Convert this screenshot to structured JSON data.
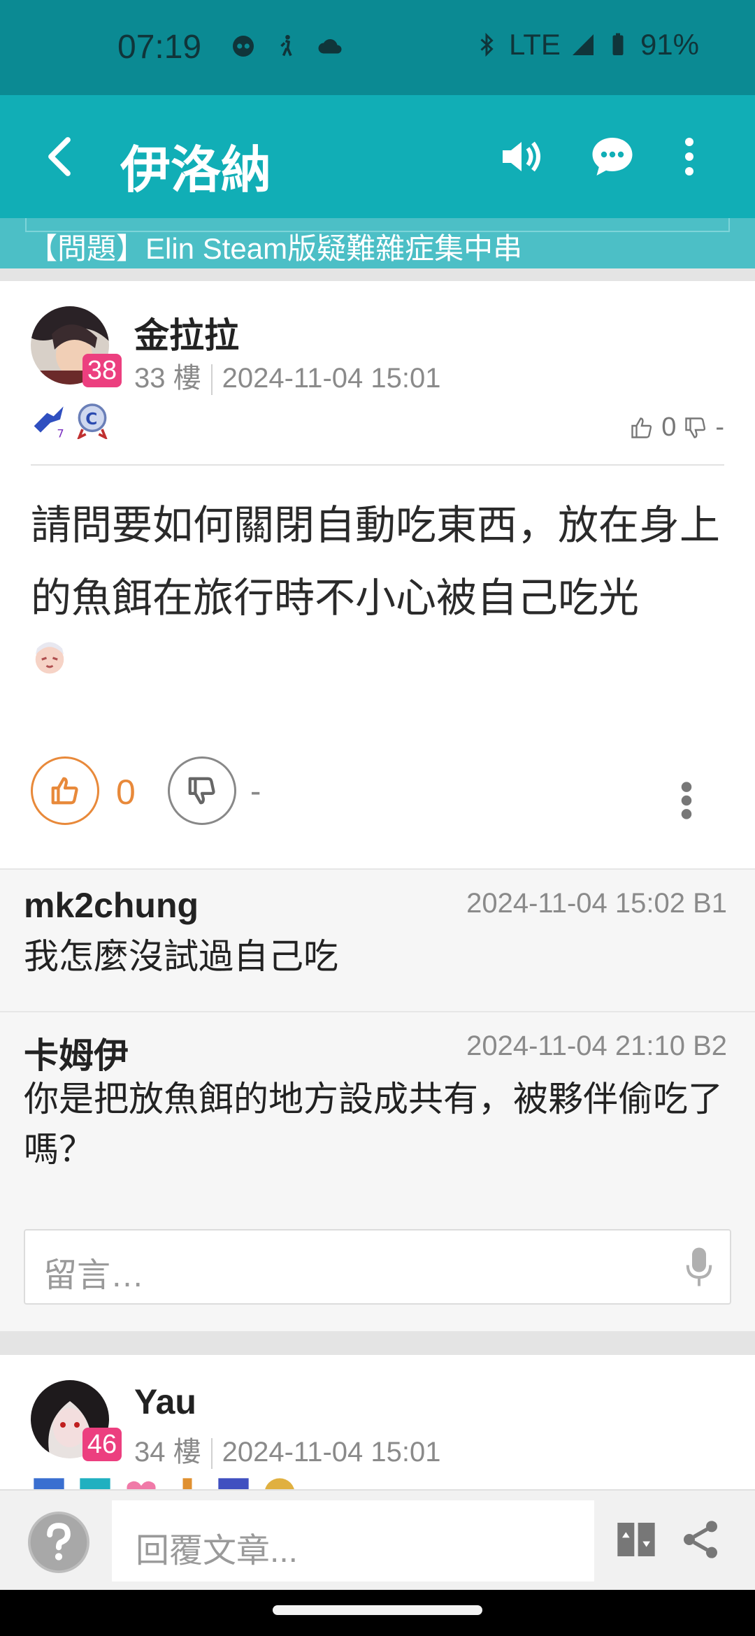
{
  "status_bar": {
    "time": "07:19",
    "network": "LTE",
    "battery": "91%"
  },
  "app_bar": {
    "title": "伊洛納"
  },
  "subject": {
    "text": "【問題】Elin Steam版疑難雜症集中串"
  },
  "post": {
    "username": "金拉拉",
    "level": "38",
    "floor": "33 樓",
    "datetime": "2024-11-04 15:01",
    "small_like_count": "0",
    "small_dislike_count": "-",
    "body": "請問要如何關閉自動吃東西，放在身上的魚餌在旅行時不小心被自己吃光",
    "like_count": "0",
    "dislike_count": "-"
  },
  "comments": [
    {
      "user": "mk2chung",
      "time": "2024-11-04 15:02  B1",
      "text": "我怎麼沒試過自己吃"
    },
    {
      "user": "卡姆伊",
      "time": "2024-11-04 21:10  B2",
      "text": "你是把放魚餌的地方設成共有，被夥伴偷吃了嗎？"
    }
  ],
  "comment_input": {
    "placeholder": "留言…"
  },
  "next_post": {
    "username": "Yau",
    "level": "46",
    "floor": "34 樓",
    "datetime": "2024-11-04 15:01"
  },
  "bottom_bar": {
    "reply_placeholder": "回覆文章..."
  },
  "colors": {
    "teal_dark": "#0b8a93",
    "teal": "#11aeb6",
    "orange": "#e8893a",
    "badge_pink": "#ec3f7f"
  }
}
